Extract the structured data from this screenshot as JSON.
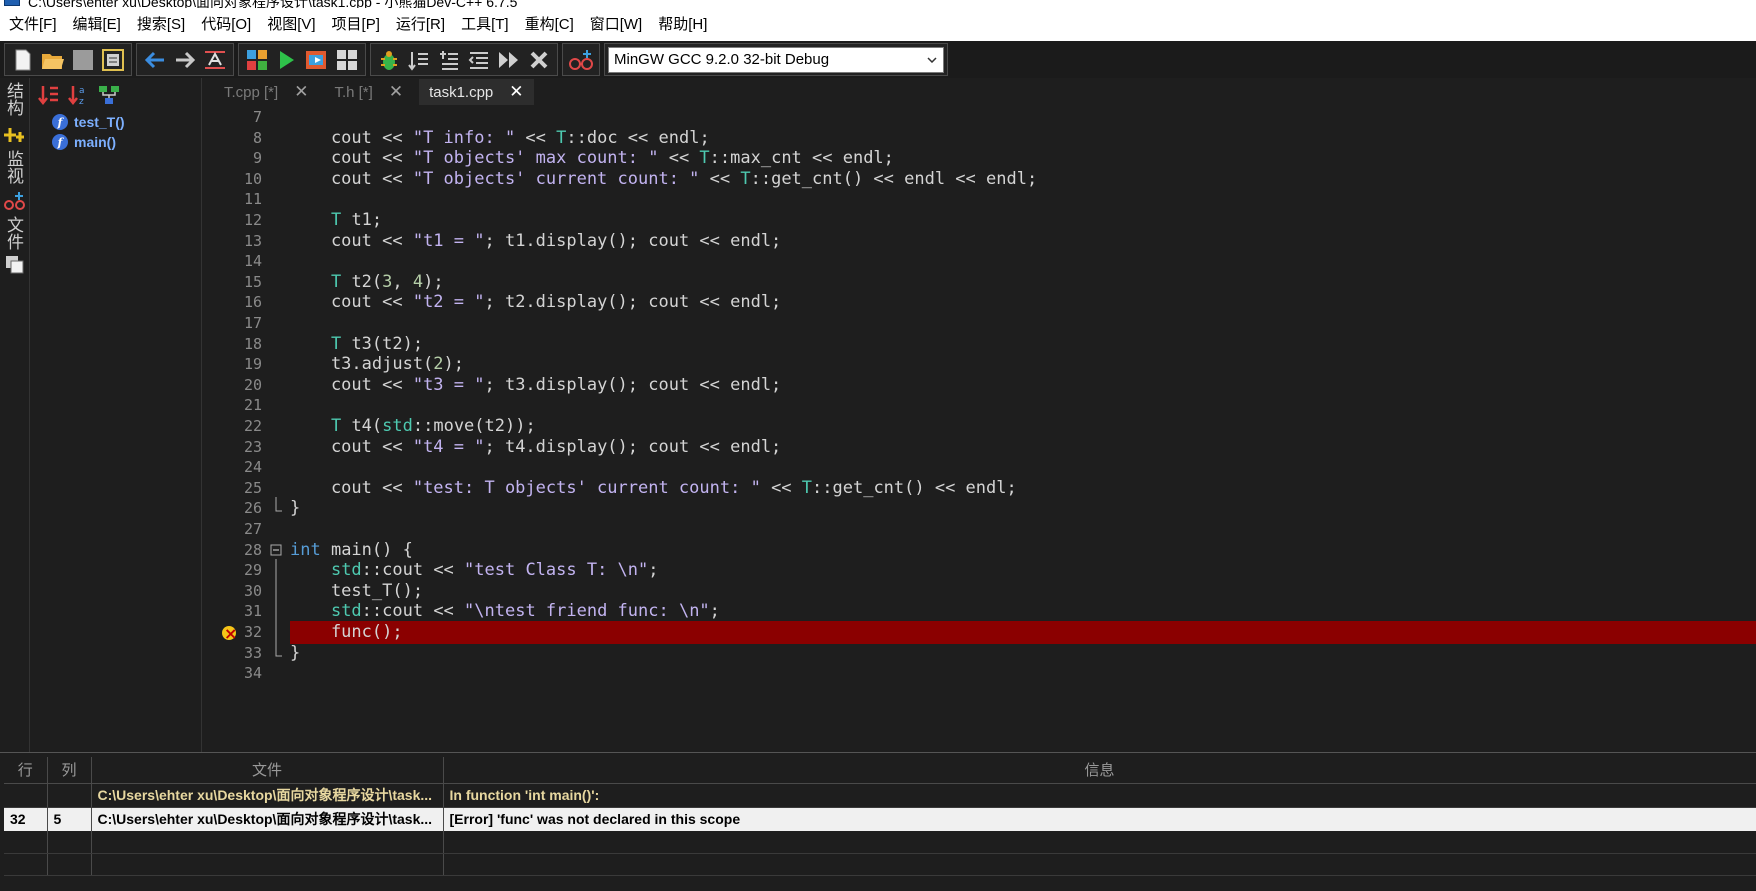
{
  "window": {
    "title": "C:\\Users\\ehter xu\\Desktop\\面向对象程序设计\\task1.cpp - 小熊猫Dev-C++ 6.7.5"
  },
  "menu": [
    "文件[F]",
    "编辑[E]",
    "搜索[S]",
    "代码[O]",
    "视图[V]",
    "项目[P]",
    "运行[R]",
    "工具[T]",
    "重构[C]",
    "窗口[W]",
    "帮助[H]"
  ],
  "toolbar": {
    "compiler": "MinGW GCC 9.2.0 32-bit Debug"
  },
  "side_tabs": [
    "结构",
    "监视",
    "文件"
  ],
  "class_browser": {
    "items": [
      "test_T()",
      "main()"
    ]
  },
  "tabs": [
    {
      "label": "T.cpp [*]",
      "active": false
    },
    {
      "label": "T.h [*]",
      "active": false
    },
    {
      "label": "task1.cpp",
      "active": true
    }
  ],
  "editor": {
    "lines": [
      {
        "n": "7",
        "t": ""
      },
      {
        "n": "8",
        "t": "    cout << \"T info: \" << T::doc << endl;"
      },
      {
        "n": "9",
        "t": "    cout << \"T objects' max count: \" << T::max_cnt << endl;"
      },
      {
        "n": "10",
        "t": "    cout << \"T objects' current count: \" << T::get_cnt() << endl << endl;"
      },
      {
        "n": "11",
        "t": ""
      },
      {
        "n": "12",
        "t": "    T t1;"
      },
      {
        "n": "13",
        "t": "    cout << \"t1 = \"; t1.display(); cout << endl;"
      },
      {
        "n": "14",
        "t": ""
      },
      {
        "n": "15",
        "t": "    T t2(3, 4);"
      },
      {
        "n": "16",
        "t": "    cout << \"t2 = \"; t2.display(); cout << endl;"
      },
      {
        "n": "17",
        "t": ""
      },
      {
        "n": "18",
        "t": "    T t3(t2);"
      },
      {
        "n": "19",
        "t": "    t3.adjust(2);"
      },
      {
        "n": "20",
        "t": "    cout << \"t3 = \"; t3.display(); cout << endl;"
      },
      {
        "n": "21",
        "t": ""
      },
      {
        "n": "22",
        "t": "    T t4(std::move(t2));"
      },
      {
        "n": "23",
        "t": "    cout << \"t4 = \"; t4.display(); cout << endl;"
      },
      {
        "n": "24",
        "t": ""
      },
      {
        "n": "25",
        "t": "    cout << \"test: T objects' current count: \" << T::get_cnt() << endl;"
      },
      {
        "n": "26",
        "t": "}"
      },
      {
        "n": "27",
        "t": ""
      },
      {
        "n": "28",
        "t": "int main() {"
      },
      {
        "n": "29",
        "t": "    std::cout << \"test Class T: \\n\";"
      },
      {
        "n": "30",
        "t": "    test_T();"
      },
      {
        "n": "31",
        "t": "    std::cout << \"\\ntest friend func: \\n\";"
      },
      {
        "n": "32",
        "t": "    func();",
        "error": true
      },
      {
        "n": "33",
        "t": "}"
      },
      {
        "n": "34",
        "t": ""
      }
    ]
  },
  "messages": {
    "headers": [
      "行",
      "列",
      "文件",
      "信息"
    ],
    "rows": [
      {
        "line": "",
        "col": "",
        "file": "C:\\Users\\ehter xu\\Desktop\\面向对象程序设计\\task...",
        "info": "In function 'int main()':"
      },
      {
        "line": "32",
        "col": "5",
        "file": "C:\\Users\\ehter xu\\Desktop\\面向对象程序设计\\task...",
        "info": "[Error] 'func' was not declared in this scope"
      }
    ]
  },
  "colors": {
    "error_line": "#8b0000",
    "type": "#4ec9b0",
    "string": "#c2b3f0",
    "keyword": "#569cd6"
  }
}
